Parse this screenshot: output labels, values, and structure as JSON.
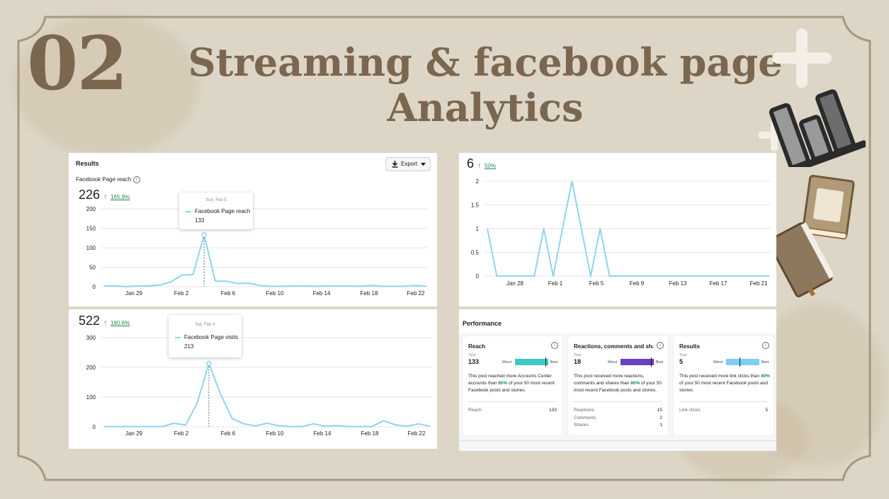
{
  "slide": {
    "number": "02",
    "title_line1": "Streaming & facebook page",
    "title_line2": "Analytics"
  },
  "colors": {
    "background": "#ddd6c6",
    "title": "#7b6650",
    "line": "#8fd4f0",
    "positive": "#1e8a52",
    "reach_bar": "#3cc9c0",
    "reactions_bar": "#6a3fc2",
    "results_bar": "#7fcdf0"
  },
  "reach_panel": {
    "header": "Results",
    "export_label": "Export",
    "subtitle": "Facebook Page reach",
    "total": "226",
    "change": "165.9%",
    "tooltip": {
      "date": "Sun, Feb 5",
      "series": "Facebook Page reach",
      "value": "133"
    }
  },
  "visits_panel": {
    "total": "522",
    "change": "180.6%",
    "tooltip": {
      "date": "Sat, Feb 4",
      "series": "Facebook Page visits",
      "value": "213"
    }
  },
  "post_panel": {
    "total": "6",
    "change": "50%"
  },
  "performance": {
    "title": "Performance",
    "cards": [
      {
        "title": "Reach",
        "total_label": "Total",
        "total": "133",
        "worst_label": "Worst",
        "best_label": "Best",
        "level": 0.92,
        "desc_before": "This post reached more Accounts Center accounts than ",
        "desc_pct": "80%",
        "desc_after": " of your 50 most recent Facebook posts and stories.",
        "rows": [
          {
            "label": "Reach",
            "value": "133"
          }
        ]
      },
      {
        "title": "Reactions, comments and sha...",
        "total_label": "Total",
        "total": "18",
        "worst_label": "Worst",
        "best_label": "Best",
        "level": 0.92,
        "desc_before": "This post received more reactions, comments and shares than ",
        "desc_pct": "80%",
        "desc_after": " of your 50 most recent Facebook posts and stories.",
        "rows": [
          {
            "label": "Reactions",
            "value": "15"
          },
          {
            "label": "Comments",
            "value": "2"
          },
          {
            "label": "Shares",
            "value": "1"
          }
        ]
      },
      {
        "title": "Results",
        "total_label": "Total",
        "total": "5",
        "worst_label": "Worst",
        "best_label": "Best",
        "level": 0.4,
        "desc_before": "This post received more link clicks than ",
        "desc_pct": "40%",
        "desc_after": " of your 50 most recent Facebook posts and stories",
        "rows": [
          {
            "label": "Link clicks",
            "value": "5"
          }
        ]
      }
    ]
  },
  "chart_data": [
    {
      "type": "line",
      "x_tick_labels": [
        "Jan 29",
        "Feb 2",
        "Feb 6",
        "Feb 10",
        "Feb 14",
        "Feb 18",
        "Feb 22"
      ],
      "ylim": [
        0,
        200
      ],
      "yticks": [
        0,
        50,
        100,
        150,
        200
      ],
      "ytick_labels": [
        "0",
        "50",
        "100",
        "150",
        "200"
      ],
      "grid": true,
      "series": [
        {
          "values": [
            2,
            2,
            0,
            2,
            2,
            4,
            12,
            30,
            31,
            133,
            14,
            14,
            8,
            9,
            3,
            1,
            1,
            2,
            2,
            1,
            2,
            2,
            2,
            1,
            3,
            1,
            1,
            1,
            3,
            1
          ]
        }
      ]
    },
    {
      "type": "line",
      "x_tick_labels": [
        "Jan 29",
        "Feb 2",
        "Feb 6",
        "Feb 10",
        "Feb 14",
        "Feb 18",
        "Feb 22"
      ],
      "ylim": [
        0,
        300
      ],
      "yticks": [
        0,
        100,
        200,
        300
      ],
      "ytick_labels": [
        "0",
        "100",
        "200",
        "300"
      ],
      "grid": true,
      "series": [
        {
          "values": [
            1,
            1,
            1,
            1,
            1,
            1,
            12,
            6,
            80,
            213,
            110,
            28,
            10,
            3,
            12,
            4,
            1,
            1,
            10,
            2,
            4,
            1,
            1,
            1,
            20,
            7,
            2,
            10,
            2
          ]
        }
      ]
    },
    {
      "type": "line",
      "x_tick_labels": [
        "Jan 28",
        "Feb 1",
        "Feb 5",
        "Feb 9",
        "Feb 13",
        "Feb 17",
        "Feb 21"
      ],
      "ylim": [
        0,
        2
      ],
      "yticks": [
        0,
        0.5,
        1,
        1.5,
        2
      ],
      "ytick_labels": [
        "0",
        "0.5",
        "1",
        "1.5",
        "2"
      ],
      "grid": true,
      "series": [
        {
          "values": [
            1,
            0,
            0,
            0,
            0,
            0,
            1,
            0,
            1,
            2,
            1,
            0,
            1,
            0,
            0,
            0,
            0,
            0,
            0,
            0,
            0,
            0,
            0,
            0,
            0,
            0,
            0,
            0,
            0,
            0,
            0
          ]
        }
      ]
    }
  ]
}
